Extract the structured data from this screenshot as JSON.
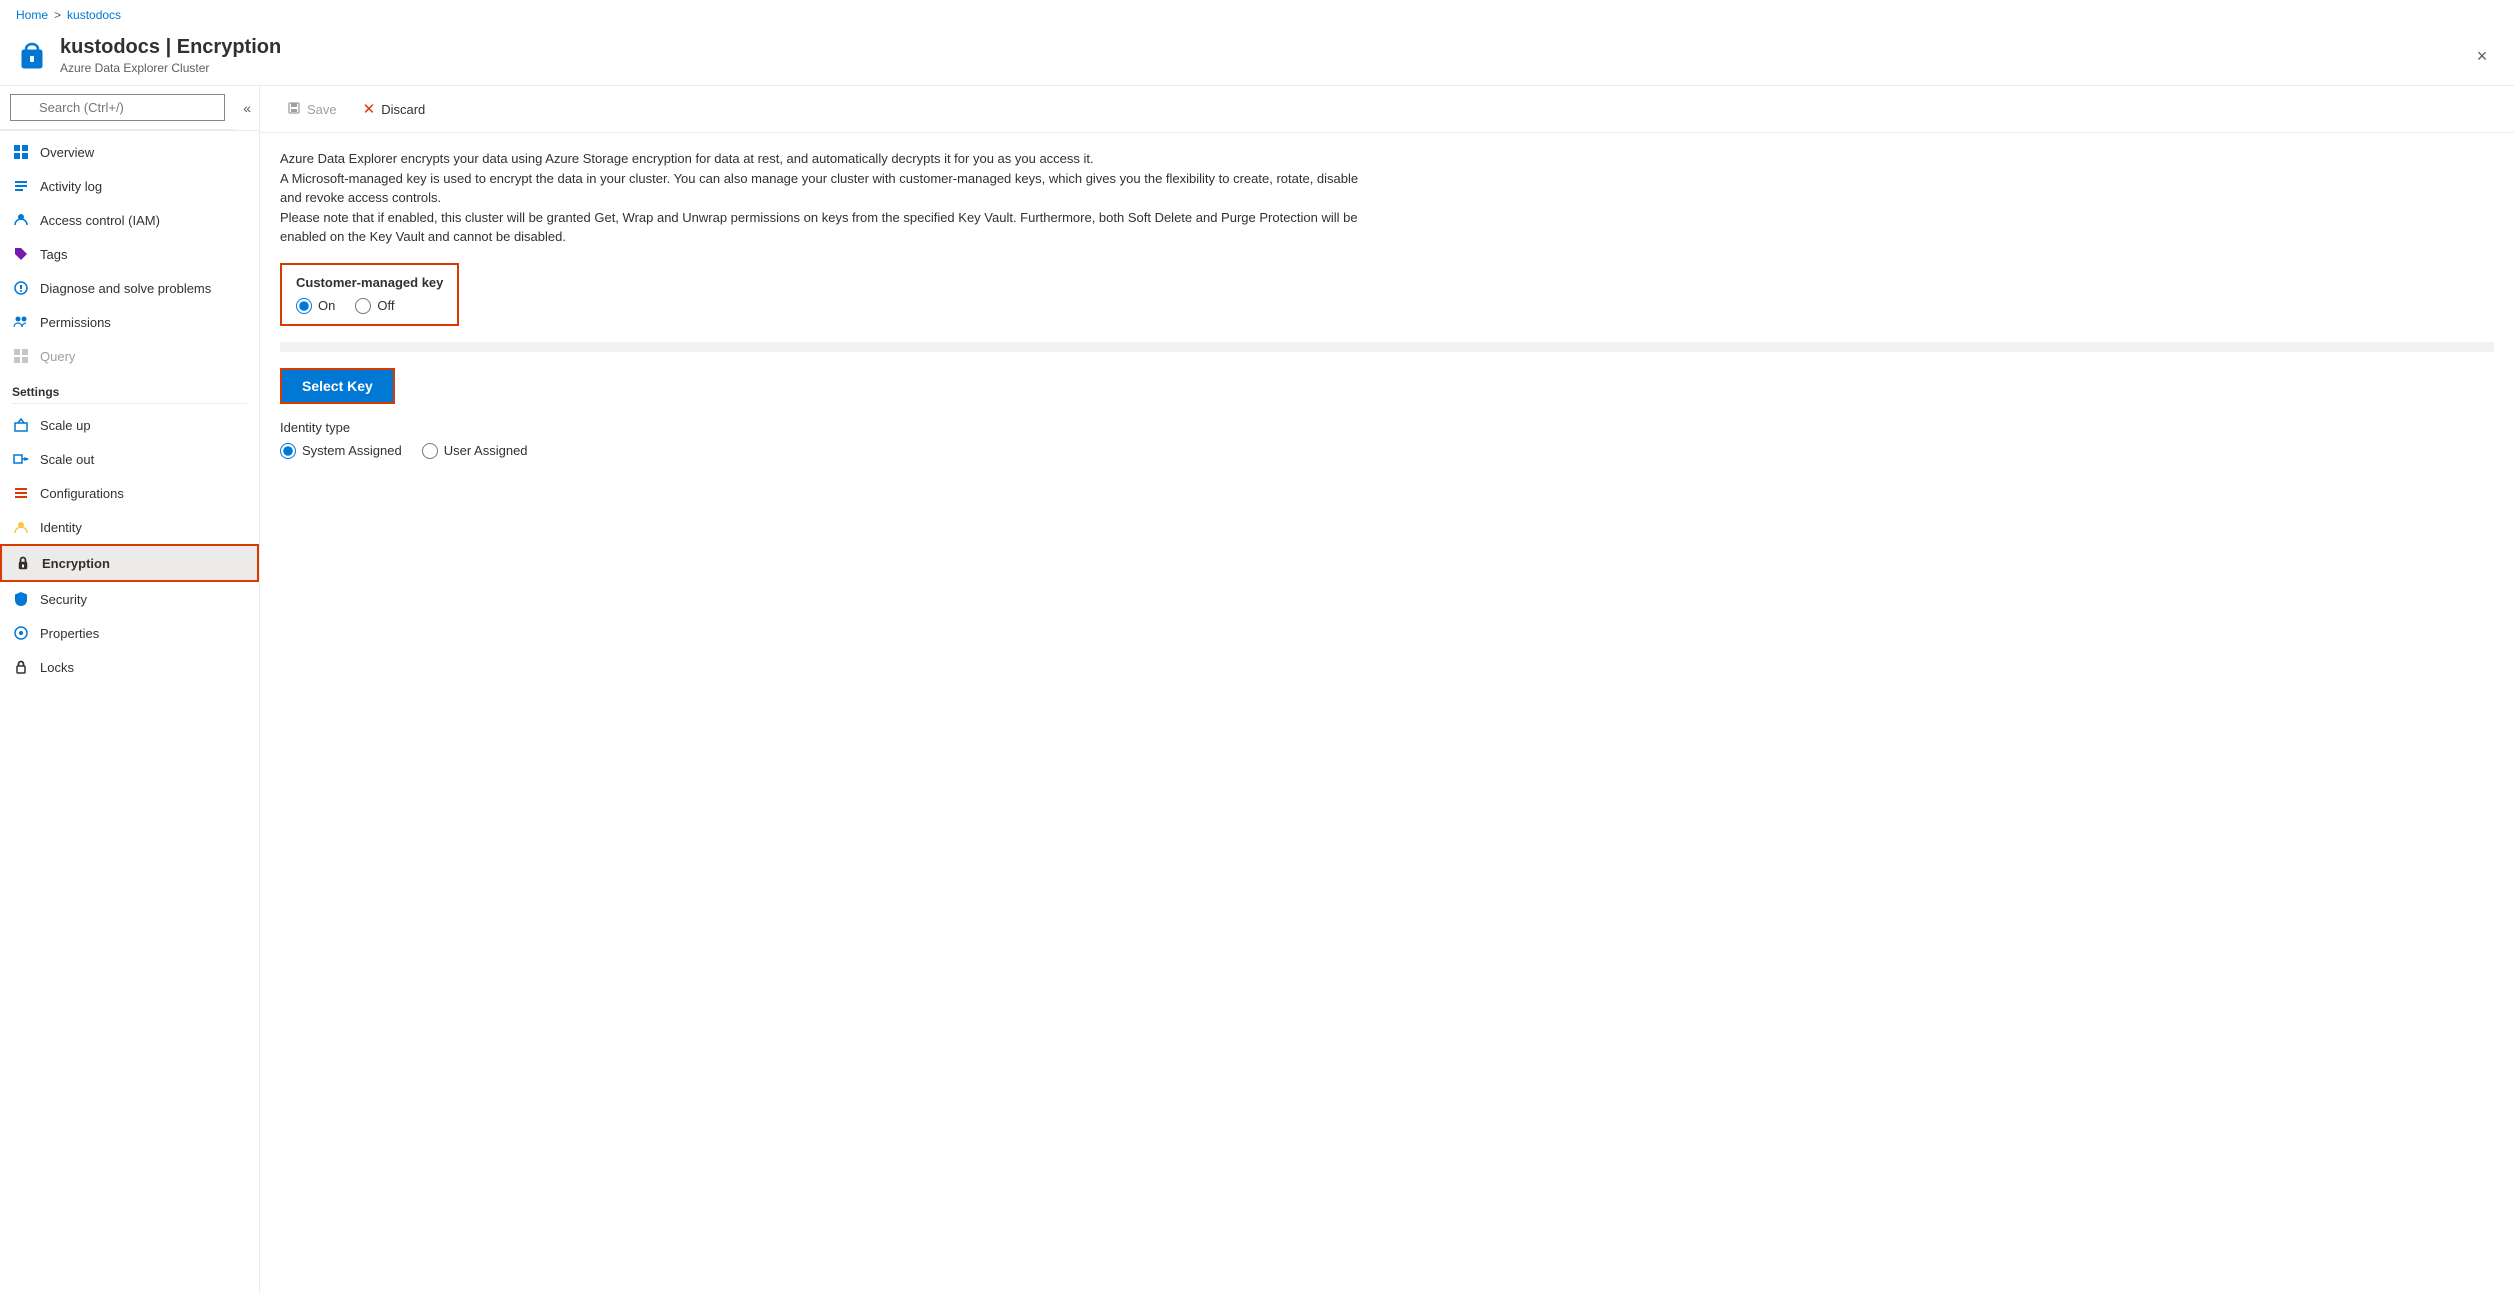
{
  "breadcrumb": {
    "home": "Home",
    "separator": ">",
    "current": "kustodocs"
  },
  "header": {
    "title": "kustodocs | Encryption",
    "subtitle": "Azure Data Explorer Cluster",
    "close_label": "×"
  },
  "toolbar": {
    "save_label": "Save",
    "discard_label": "Discard"
  },
  "description": {
    "line1": "Azure Data Explorer encrypts your data using Azure Storage encryption for data at rest, and automatically decrypts it for you as you access it.",
    "line2": "A Microsoft-managed key is used to encrypt the data in your cluster. You can also manage your cluster with customer-managed keys, which gives you the flexibility to create, rotate, disable and revoke access controls.",
    "line3": "Please note that if enabled, this cluster will be granted Get, Wrap and Unwrap permissions on keys from the specified Key Vault. Furthermore, both Soft Delete and Purge Protection will be enabled on the Key Vault and cannot be disabled."
  },
  "customer_managed_key": {
    "label": "Customer-managed key",
    "on_label": "On",
    "off_label": "Off",
    "selected": "on"
  },
  "select_key_button": "Select Key",
  "identity_type": {
    "label": "Identity type",
    "system_assigned": "System Assigned",
    "user_assigned": "User Assigned",
    "selected": "system"
  },
  "search": {
    "placeholder": "Search (Ctrl+/)"
  },
  "sidebar": {
    "nav_items": [
      {
        "id": "overview",
        "label": "Overview",
        "icon": "grid"
      },
      {
        "id": "activity-log",
        "label": "Activity log",
        "icon": "list"
      },
      {
        "id": "access-control",
        "label": "Access control (IAM)",
        "icon": "person"
      },
      {
        "id": "tags",
        "label": "Tags",
        "icon": "tag"
      },
      {
        "id": "diagnose",
        "label": "Diagnose and solve problems",
        "icon": "wrench"
      },
      {
        "id": "permissions",
        "label": "Permissions",
        "icon": "people"
      },
      {
        "id": "query",
        "label": "Query",
        "icon": "grid-small",
        "disabled": true
      }
    ],
    "settings_label": "Settings",
    "settings_items": [
      {
        "id": "scale-up",
        "label": "Scale up",
        "icon": "scale-up"
      },
      {
        "id": "scale-out",
        "label": "Scale out",
        "icon": "scale-out"
      },
      {
        "id": "configurations",
        "label": "Configurations",
        "icon": "sliders"
      },
      {
        "id": "identity",
        "label": "Identity",
        "icon": "identity"
      },
      {
        "id": "encryption",
        "label": "Encryption",
        "icon": "lock",
        "active": true
      },
      {
        "id": "security",
        "label": "Security",
        "icon": "shield"
      },
      {
        "id": "properties",
        "label": "Properties",
        "icon": "properties"
      },
      {
        "id": "locks",
        "label": "Locks",
        "icon": "lock-small"
      }
    ]
  }
}
